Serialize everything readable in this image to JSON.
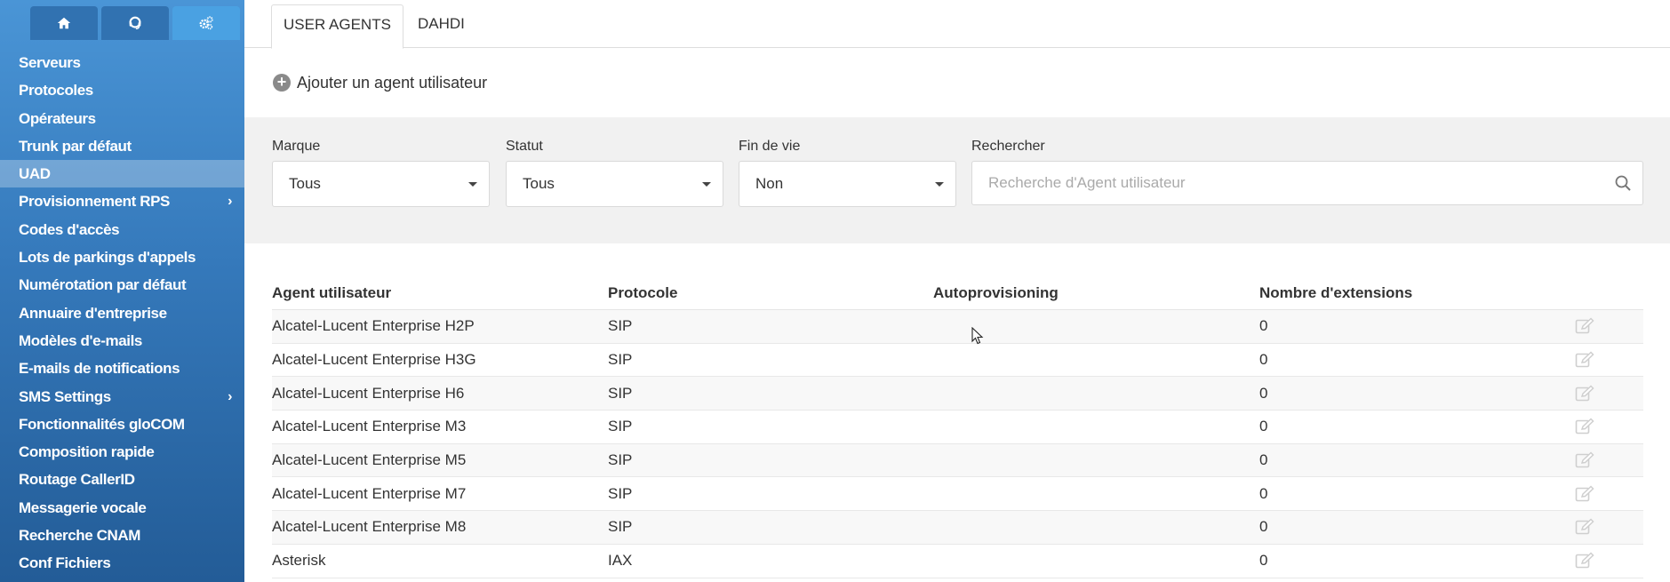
{
  "sidebar": {
    "top_tabs": [
      {
        "icon": "home-icon"
      },
      {
        "icon": "headset-icon"
      },
      {
        "icon": "gears-icon",
        "active": true
      }
    ],
    "items": [
      {
        "label": "Serveurs"
      },
      {
        "label": "Protocoles"
      },
      {
        "label": "Opérateurs"
      },
      {
        "label": "Trunk par défaut"
      },
      {
        "label": "UAD",
        "active": true
      },
      {
        "label": "Provisionnement RPS",
        "has_submenu": true
      },
      {
        "label": "Codes d'accès"
      },
      {
        "label": "Lots de parkings d'appels"
      },
      {
        "label": "Numérotation par défaut"
      },
      {
        "label": "Annuaire d'entreprise"
      },
      {
        "label": "Modèles d'e-mails"
      },
      {
        "label": "E-mails de notifications"
      },
      {
        "label": "SMS Settings",
        "has_submenu": true
      },
      {
        "label": "Fonctionnalités gloCOM"
      },
      {
        "label": "Composition rapide"
      },
      {
        "label": "Routage CallerID"
      },
      {
        "label": "Messagerie vocale"
      },
      {
        "label": "Recherche CNAM"
      },
      {
        "label": "Conf Fichiers"
      }
    ],
    "chevron": "›"
  },
  "tabs": [
    {
      "label": "USER AGENTS",
      "active": true
    },
    {
      "label": "DAHDI"
    }
  ],
  "add_button": {
    "icon": "plus-circle-icon",
    "glyph": "+",
    "label": "Ajouter un agent utilisateur"
  },
  "filters": {
    "brand": {
      "label": "Marque",
      "value": "Tous"
    },
    "status": {
      "label": "Statut",
      "value": "Tous"
    },
    "eol": {
      "label": "Fin de vie",
      "value": "Non"
    },
    "search": {
      "label": "Rechercher",
      "placeholder": "Recherche d'Agent utilisateur",
      "icon": "search-icon"
    }
  },
  "table": {
    "headers": [
      "Agent utilisateur",
      "Protocole",
      "Autoprovisioning",
      "Nombre d'extensions"
    ],
    "rows": [
      {
        "agent": "Alcatel-Lucent Enterprise H2P",
        "protocol": "SIP",
        "autoprov": "",
        "extensions": "0"
      },
      {
        "agent": "Alcatel-Lucent Enterprise H3G",
        "protocol": "SIP",
        "autoprov": "",
        "extensions": "0"
      },
      {
        "agent": "Alcatel-Lucent Enterprise H6",
        "protocol": "SIP",
        "autoprov": "",
        "extensions": "0"
      },
      {
        "agent": "Alcatel-Lucent Enterprise M3",
        "protocol": "SIP",
        "autoprov": "",
        "extensions": "0"
      },
      {
        "agent": "Alcatel-Lucent Enterprise M5",
        "protocol": "SIP",
        "autoprov": "",
        "extensions": "0"
      },
      {
        "agent": "Alcatel-Lucent Enterprise M7",
        "protocol": "SIP",
        "autoprov": "",
        "extensions": "0"
      },
      {
        "agent": "Alcatel-Lucent Enterprise M8",
        "protocol": "SIP",
        "autoprov": "",
        "extensions": "0"
      },
      {
        "agent": "Asterisk",
        "protocol": "IAX",
        "autoprov": "",
        "extensions": "0"
      }
    ],
    "row_action_icon": "edit-icon"
  },
  "colors": {
    "sidebar_top": "#4a95d6",
    "sidebar_bottom": "#235c97",
    "active_tab": "#4aa1e2",
    "filter_bg": "#f1f1f1"
  }
}
